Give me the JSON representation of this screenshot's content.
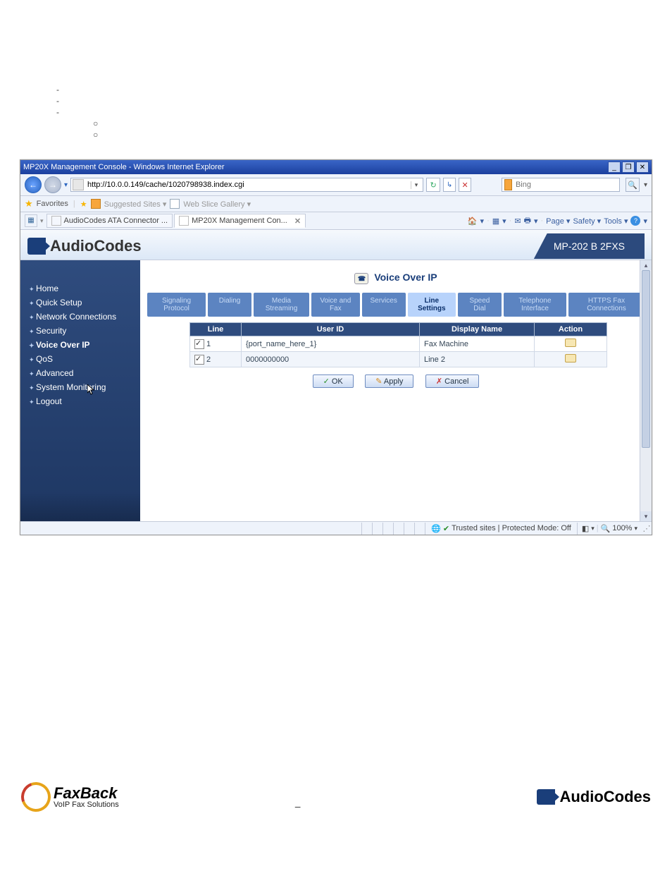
{
  "browser": {
    "title": "MP20X Management Console - Windows Internet Explorer",
    "url": "http://10.0.0.149/cache/1020798938.index.cgi",
    "search_provider": "Bing",
    "search_value": "",
    "win_buttons": {
      "min": "_",
      "max": "❐",
      "close": "✕"
    },
    "favorites_label": "Favorites",
    "suggested_sites": "Suggested Sites",
    "web_slice": "Web Slice Gallery",
    "tabs": [
      {
        "label": "AudioCodes ATA Connector ...",
        "active": false
      },
      {
        "label": "MP20X Management Con...",
        "active": true
      }
    ],
    "command_bar": [
      "Page",
      "Safety",
      "Tools"
    ]
  },
  "app": {
    "brand": "AudioCodes",
    "model": "MP-202 B 2FXS",
    "page_title": "Voice Over IP",
    "sidebar": [
      "Home",
      "Quick Setup",
      "Network Connections",
      "Security",
      "Voice Over IP",
      "QoS",
      "Advanced",
      "System Monitoring",
      "Logout"
    ],
    "subtabs": [
      "Signaling Protocol",
      "Dialing",
      "Media Streaming",
      "Voice and Fax",
      "Services",
      "Line Settings",
      "Speed Dial",
      "Telephone Interface",
      "HTTPS Fax Connections"
    ],
    "subtab_active_index": 5,
    "table": {
      "headers": [
        "Line",
        "User ID",
        "Display Name",
        "Action"
      ],
      "rows": [
        {
          "checked": true,
          "line": "1",
          "user_id": "{port_name_here_1}",
          "display_name": "Fax Machine"
        },
        {
          "checked": true,
          "line": "2",
          "user_id": "0000000000",
          "display_name": "Line 2"
        }
      ]
    },
    "buttons": {
      "ok": "OK",
      "apply": "Apply",
      "cancel": "Cancel"
    }
  },
  "statusbar": {
    "zone": "Trusted sites | Protected Mode: Off",
    "zoom": "100%"
  },
  "footer": {
    "faxback_main": "FaxBack",
    "faxback_sub": "VoIP Fax Solutions",
    "sep": "–",
    "audiocodes": "AudioCodes"
  }
}
